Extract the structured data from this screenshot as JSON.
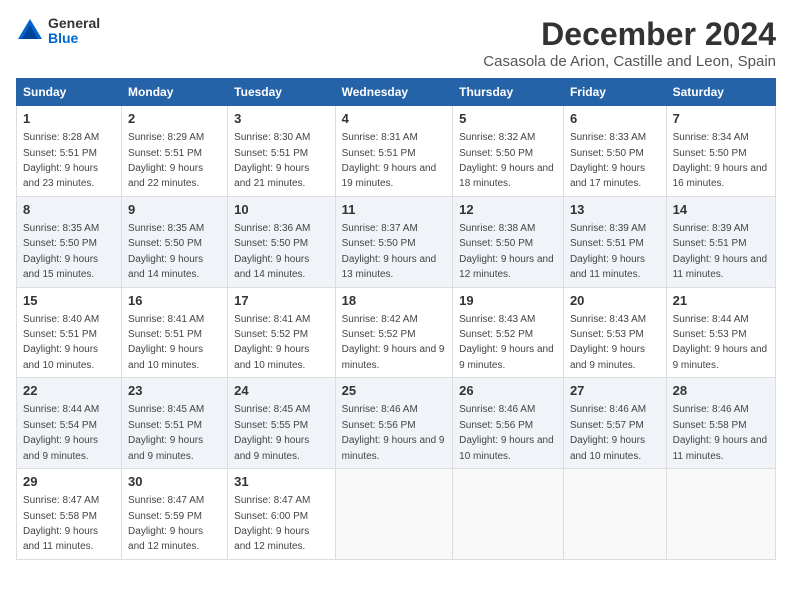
{
  "logo": {
    "line1": "General",
    "line2": "Blue"
  },
  "title": "December 2024",
  "location": "Casasola de Arion, Castille and Leon, Spain",
  "weekdays": [
    "Sunday",
    "Monday",
    "Tuesday",
    "Wednesday",
    "Thursday",
    "Friday",
    "Saturday"
  ],
  "weeks": [
    [
      {
        "day": "1",
        "sunrise": "8:28 AM",
        "sunset": "5:51 PM",
        "daylight": "9 hours and 23 minutes."
      },
      {
        "day": "2",
        "sunrise": "8:29 AM",
        "sunset": "5:51 PM",
        "daylight": "9 hours and 22 minutes."
      },
      {
        "day": "3",
        "sunrise": "8:30 AM",
        "sunset": "5:51 PM",
        "daylight": "9 hours and 21 minutes."
      },
      {
        "day": "4",
        "sunrise": "8:31 AM",
        "sunset": "5:51 PM",
        "daylight": "9 hours and 19 minutes."
      },
      {
        "day": "5",
        "sunrise": "8:32 AM",
        "sunset": "5:50 PM",
        "daylight": "9 hours and 18 minutes."
      },
      {
        "day": "6",
        "sunrise": "8:33 AM",
        "sunset": "5:50 PM",
        "daylight": "9 hours and 17 minutes."
      },
      {
        "day": "7",
        "sunrise": "8:34 AM",
        "sunset": "5:50 PM",
        "daylight": "9 hours and 16 minutes."
      }
    ],
    [
      {
        "day": "8",
        "sunrise": "8:35 AM",
        "sunset": "5:50 PM",
        "daylight": "9 hours and 15 minutes."
      },
      {
        "day": "9",
        "sunrise": "8:35 AM",
        "sunset": "5:50 PM",
        "daylight": "9 hours and 14 minutes."
      },
      {
        "day": "10",
        "sunrise": "8:36 AM",
        "sunset": "5:50 PM",
        "daylight": "9 hours and 14 minutes."
      },
      {
        "day": "11",
        "sunrise": "8:37 AM",
        "sunset": "5:50 PM",
        "daylight": "9 hours and 13 minutes."
      },
      {
        "day": "12",
        "sunrise": "8:38 AM",
        "sunset": "5:50 PM",
        "daylight": "9 hours and 12 minutes."
      },
      {
        "day": "13",
        "sunrise": "8:39 AM",
        "sunset": "5:51 PM",
        "daylight": "9 hours and 11 minutes."
      },
      {
        "day": "14",
        "sunrise": "8:39 AM",
        "sunset": "5:51 PM",
        "daylight": "9 hours and 11 minutes."
      }
    ],
    [
      {
        "day": "15",
        "sunrise": "8:40 AM",
        "sunset": "5:51 PM",
        "daylight": "9 hours and 10 minutes."
      },
      {
        "day": "16",
        "sunrise": "8:41 AM",
        "sunset": "5:51 PM",
        "daylight": "9 hours and 10 minutes."
      },
      {
        "day": "17",
        "sunrise": "8:41 AM",
        "sunset": "5:52 PM",
        "daylight": "9 hours and 10 minutes."
      },
      {
        "day": "18",
        "sunrise": "8:42 AM",
        "sunset": "5:52 PM",
        "daylight": "9 hours and 9 minutes."
      },
      {
        "day": "19",
        "sunrise": "8:43 AM",
        "sunset": "5:52 PM",
        "daylight": "9 hours and 9 minutes."
      },
      {
        "day": "20",
        "sunrise": "8:43 AM",
        "sunset": "5:53 PM",
        "daylight": "9 hours and 9 minutes."
      },
      {
        "day": "21",
        "sunrise": "8:44 AM",
        "sunset": "5:53 PM",
        "daylight": "9 hours and 9 minutes."
      }
    ],
    [
      {
        "day": "22",
        "sunrise": "8:44 AM",
        "sunset": "5:54 PM",
        "daylight": "9 hours and 9 minutes."
      },
      {
        "day": "23",
        "sunrise": "8:45 AM",
        "sunset": "5:51 PM",
        "daylight": "9 hours and 9 minutes."
      },
      {
        "day": "24",
        "sunrise": "8:45 AM",
        "sunset": "5:55 PM",
        "daylight": "9 hours and 9 minutes."
      },
      {
        "day": "25",
        "sunrise": "8:46 AM",
        "sunset": "5:56 PM",
        "daylight": "9 hours and 9 minutes."
      },
      {
        "day": "26",
        "sunrise": "8:46 AM",
        "sunset": "5:56 PM",
        "daylight": "9 hours and 10 minutes."
      },
      {
        "day": "27",
        "sunrise": "8:46 AM",
        "sunset": "5:57 PM",
        "daylight": "9 hours and 10 minutes."
      },
      {
        "day": "28",
        "sunrise": "8:46 AM",
        "sunset": "5:58 PM",
        "daylight": "9 hours and 11 minutes."
      }
    ],
    [
      {
        "day": "29",
        "sunrise": "8:47 AM",
        "sunset": "5:58 PM",
        "daylight": "9 hours and 11 minutes."
      },
      {
        "day": "30",
        "sunrise": "8:47 AM",
        "sunset": "5:59 PM",
        "daylight": "9 hours and 12 minutes."
      },
      {
        "day": "31",
        "sunrise": "8:47 AM",
        "sunset": "6:00 PM",
        "daylight": "9 hours and 12 minutes."
      },
      null,
      null,
      null,
      null
    ]
  ]
}
